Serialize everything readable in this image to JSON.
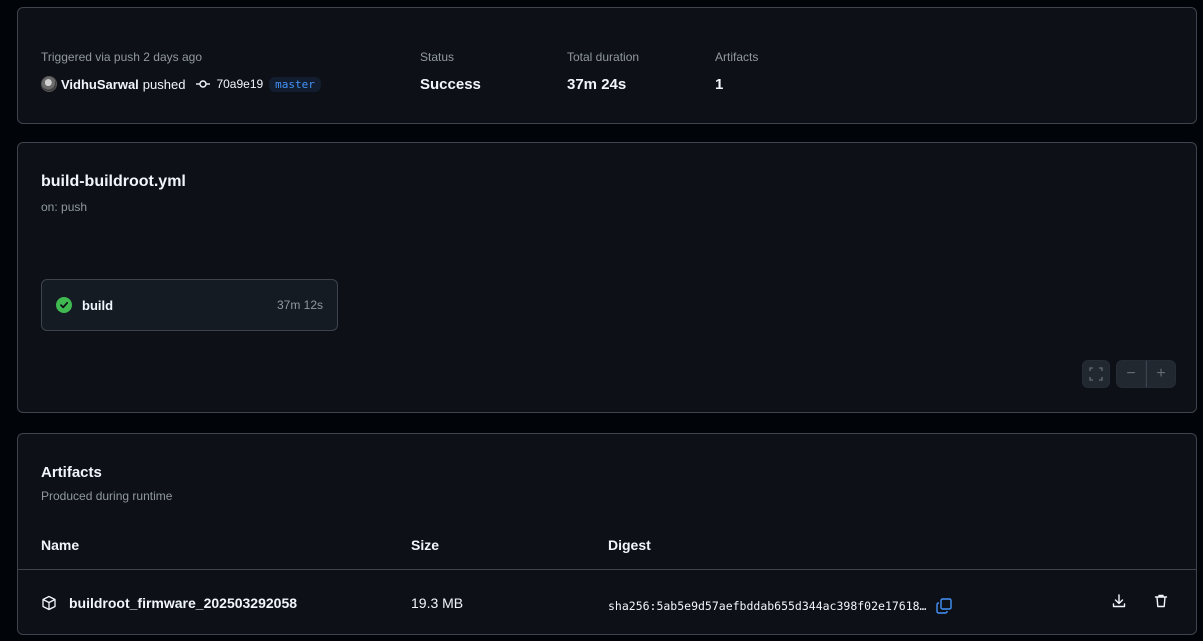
{
  "summary": {
    "trigger_label": "Triggered via push 2 days ago",
    "user": "VidhuSarwal",
    "action": "pushed",
    "commit_sha": "70a9e19",
    "branch": "master",
    "status_label": "Status",
    "status_value": "Success",
    "duration_label": "Total duration",
    "duration_value": "37m 24s",
    "artifacts_label": "Artifacts",
    "artifacts_value": "1"
  },
  "workflow": {
    "title": "build-buildroot.yml",
    "trigger": "on: push",
    "job": {
      "name": "build",
      "duration": "37m 12s",
      "status": "success"
    },
    "controls": {
      "fullscreen_icon": "fullscreen-icon",
      "zoom_out": "−",
      "zoom_in": "+"
    }
  },
  "artifacts": {
    "title": "Artifacts",
    "subtitle": "Produced during runtime",
    "columns": {
      "name": "Name",
      "size": "Size",
      "digest": "Digest"
    },
    "rows": [
      {
        "name": "buildroot_firmware_202503292058",
        "size": "19.3 MB",
        "digest": "sha256:5ab5e9d57aefbddab655d344ac398f02e17618…"
      }
    ]
  },
  "colors": {
    "background": "#010409",
    "card": "#0d1117",
    "border": "#3d444d",
    "success": "#3fb950",
    "branch_text": "#4493f8"
  }
}
